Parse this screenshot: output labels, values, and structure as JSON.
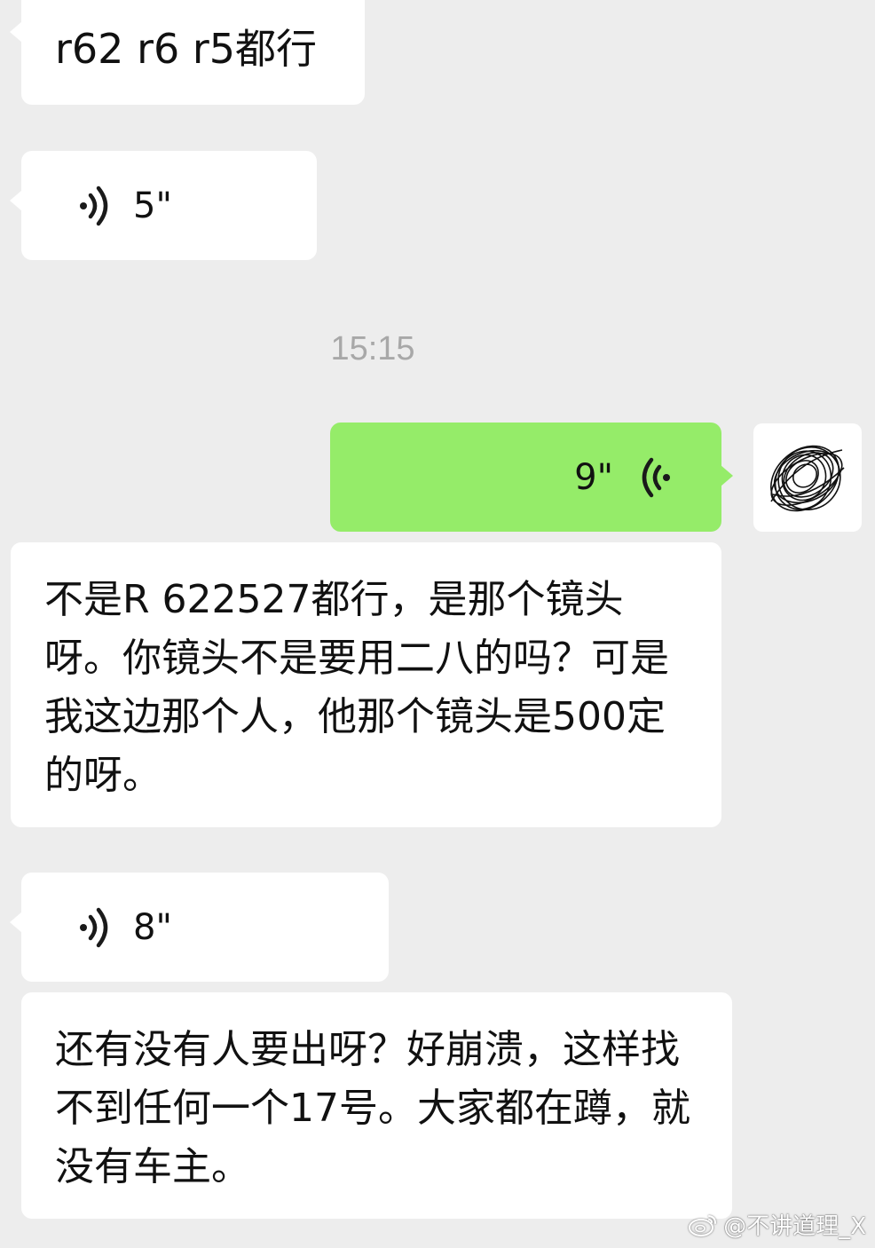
{
  "messages": {
    "m1_text": "r62 r6 r5都行",
    "m2_voice_duration": "5\"",
    "timestamp": "15:15",
    "m3_voice_duration": "9\"",
    "m4_text": "不是R 622527都行，是那个镜头呀。你镜头不是要用二八的吗？可是我这边那个人，他那个镜头是500定的呀。",
    "m5_voice_duration": "8\"",
    "m6_text": "还有没有人要出呀？好崩溃，这样找不到任何一个17号。大家都在蹲，就没有车主。"
  },
  "watermark": {
    "text": "@不讲道理_X",
    "icon": "weibo-icon"
  },
  "colors": {
    "background": "#ededed",
    "incoming_bubble": "#ffffff",
    "outgoing_bubble": "#95ec69",
    "timestamp": "#a8a8a8"
  }
}
